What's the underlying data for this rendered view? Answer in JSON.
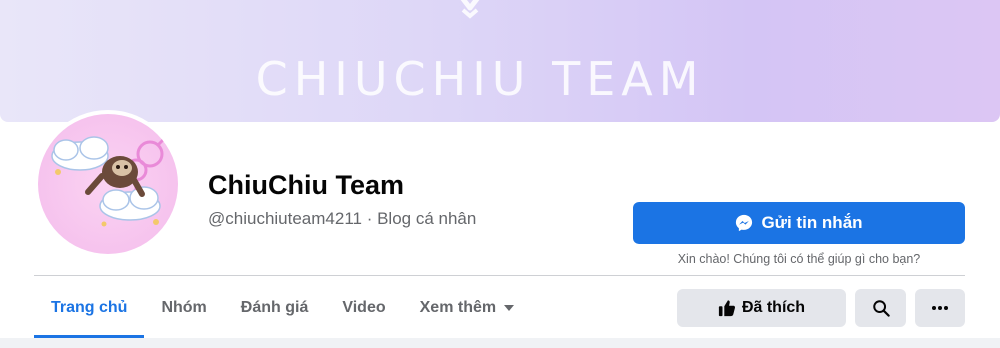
{
  "cover": {
    "title": "CHIUCHIU TEAM"
  },
  "page": {
    "name": "ChiuChiu Team",
    "subtitle": "@chiuchiuteam4211 · Blog cá nhân"
  },
  "actions": {
    "message_label": "Gửi tin nhắn",
    "greeting": "Xin chào! Chúng tôi có thể giúp gì cho bạn?",
    "liked_label": "Đã thích"
  },
  "tabs": [
    {
      "label": "Trang chủ",
      "active": true
    },
    {
      "label": "Nhóm"
    },
    {
      "label": "Đánh giá"
    },
    {
      "label": "Video"
    },
    {
      "label": "Xem thêm"
    }
  ],
  "colors": {
    "accent": "#1b74e4",
    "muted_text": "#65676b",
    "button_gray": "#e4e6eb"
  },
  "icons": [
    "messenger-icon",
    "thumbs-up-icon",
    "search-icon",
    "more-icon",
    "chevron-down-icon"
  ]
}
